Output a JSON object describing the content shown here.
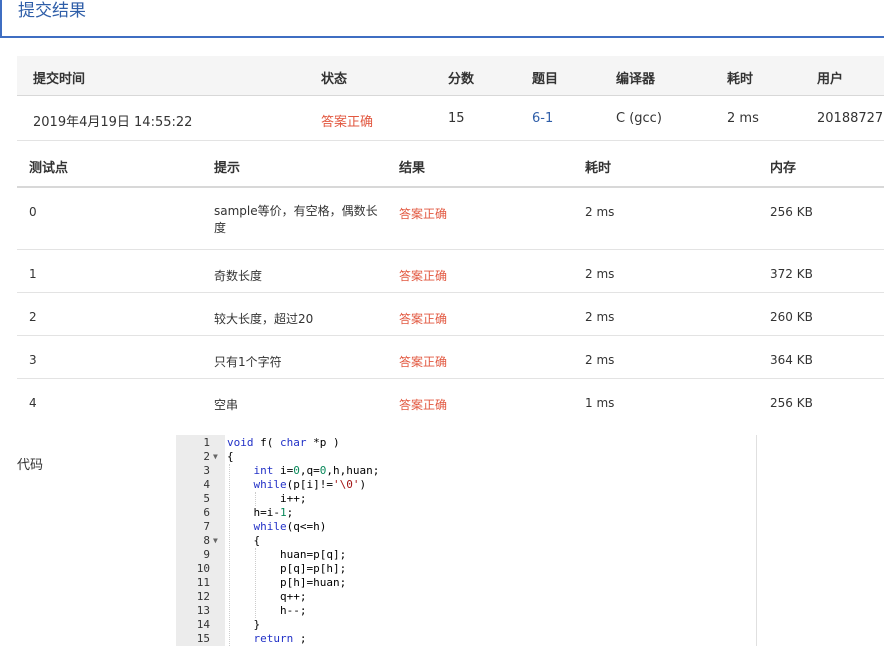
{
  "header": {
    "title": "提交结果"
  },
  "summary": {
    "headers": [
      "提交时间",
      "状态",
      "分数",
      "题目",
      "编译器",
      "耗时",
      "用户"
    ],
    "values": [
      "2019年4月19日 14:55:22",
      "答案正确",
      "15",
      "6-1",
      "C (gcc)",
      "2 ms",
      "20188727"
    ]
  },
  "tests": {
    "headers": [
      "测试点",
      "提示",
      "结果",
      "耗时",
      "内存"
    ],
    "rows": [
      {
        "id": "0",
        "hint": "sample等价，有空格，偶数长度",
        "result": "答案正确",
        "time": "2 ms",
        "memory": "256 KB"
      },
      {
        "id": "1",
        "hint": "奇数长度",
        "result": "答案正确",
        "time": "2 ms",
        "memory": "372 KB"
      },
      {
        "id": "2",
        "hint": "较大长度，超过20",
        "result": "答案正确",
        "time": "2 ms",
        "memory": "260 KB"
      },
      {
        "id": "3",
        "hint": "只有1个字符",
        "result": "答案正确",
        "time": "2 ms",
        "memory": "364 KB"
      },
      {
        "id": "4",
        "hint": "空串",
        "result": "答案正确",
        "time": "1 ms",
        "memory": "256 KB"
      }
    ]
  },
  "code": {
    "label": "代码",
    "line_numbers": [
      "1",
      "2",
      "3",
      "4",
      "5",
      "6",
      "7",
      "8",
      "9",
      "10",
      "11",
      "12",
      "13",
      "14",
      "15"
    ],
    "lines": [
      "void f( char *p )",
      "{",
      "    int i=0,q=0,h,huan;",
      "    while(p[i]!='\\0')",
      "        i++;",
      "    h=i-1;",
      "    while(q<=h)",
      "    {",
      "        huan=p[q];",
      "        p[q]=p[h];",
      "        p[h]=huan;",
      "        q++;",
      "        h--;",
      "    }",
      "    return ;"
    ],
    "fold_markers": {
      "2": "▼",
      "8": "▼"
    }
  },
  "colors": {
    "accent": "#2f5ea8",
    "accepted": "#e25840",
    "header_border": "#3f6ec2"
  }
}
